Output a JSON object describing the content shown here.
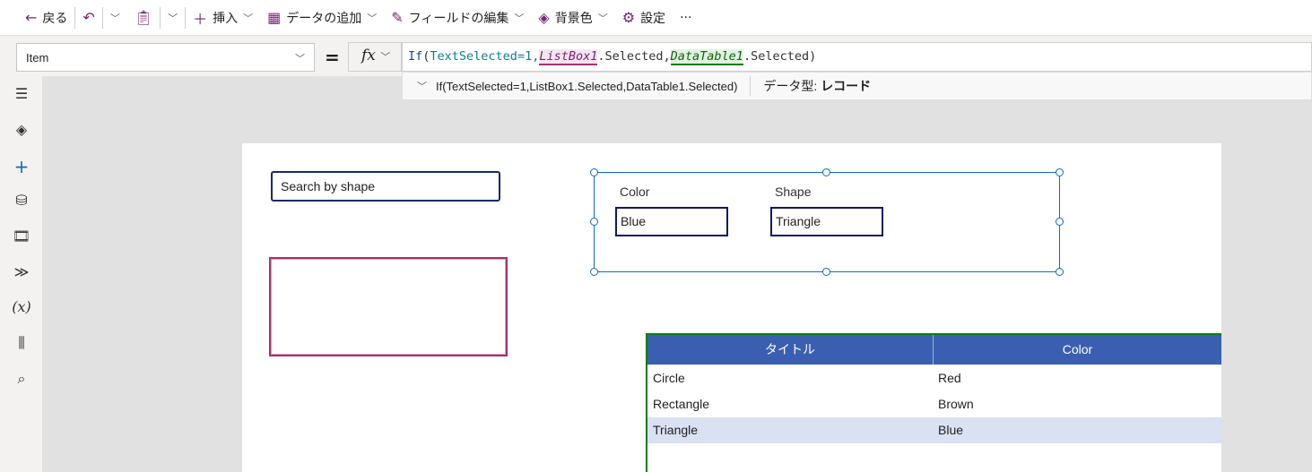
{
  "toolbar": {
    "back": "戻る",
    "insert": "挿入",
    "add_data": "データの追加",
    "edit_fields": "フィールドの編集",
    "background": "背景色",
    "settings": "設定",
    "more": "···"
  },
  "formula_bar": {
    "property": "Item",
    "equals": "=",
    "fx": "fx",
    "formula_parts": {
      "if": "If",
      "paren_open": "(",
      "var": "TextSelected",
      "eq1": "=1,",
      "listbox": "ListBox1",
      "sel1": ".Selected,",
      "datatable": "DataTable1",
      "sel2": ".Selected",
      "paren_close": ")"
    },
    "hint_formula": "If(TextSelected=1,ListBox1.Selected,DataTable1.Selected)",
    "data_type_label": "データ型:",
    "data_type_value": "レコード"
  },
  "canvas": {
    "search_placeholder": "Search by shape",
    "form": {
      "color_label": "Color",
      "color_value": "Blue",
      "shape_label": "Shape",
      "shape_value": "Triangle"
    },
    "table": {
      "headers": [
        "タイトル",
        "Color"
      ],
      "rows": [
        [
          "Circle",
          "Red"
        ],
        [
          "Rectangle",
          "Brown"
        ],
        [
          "Triangle",
          "Blue"
        ]
      ],
      "selected_row": 2
    }
  },
  "colors": {
    "accent": "#742774",
    "header": "#3a5fb0",
    "selected_row": "#d9e1f2",
    "selection": "#0f6cbd"
  }
}
